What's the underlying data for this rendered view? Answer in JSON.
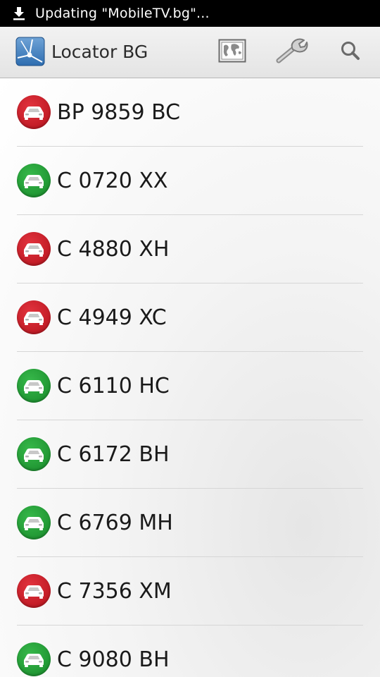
{
  "status_bar": {
    "icon": "download-icon",
    "text": "Updating \"MobileTV.bg\"..."
  },
  "action_bar": {
    "logo_icon": "locator-map-icon",
    "title": "Locator BG",
    "buttons": [
      {
        "icon": "map-icon"
      },
      {
        "icon": "wrench-icon"
      },
      {
        "icon": "search-icon"
      }
    ]
  },
  "vehicles": [
    {
      "plate": "BP 9859 BC",
      "status": "red"
    },
    {
      "plate": "C 0720 XX",
      "status": "green"
    },
    {
      "plate": "C 4880 XH",
      "status": "red"
    },
    {
      "plate": "C 4949 XC",
      "status": "red"
    },
    {
      "plate": "C 6110 HC",
      "status": "green"
    },
    {
      "plate": "C 6172 BH",
      "status": "green"
    },
    {
      "plate": "C 6769 MH",
      "status": "green"
    },
    {
      "plate": "C 7356 XM",
      "status": "red"
    },
    {
      "plate": "C 9080 BH",
      "status": "green"
    }
  ],
  "colors": {
    "status_red": "#c8202b",
    "status_green": "#22a036",
    "status_bar_bg": "#000000"
  }
}
